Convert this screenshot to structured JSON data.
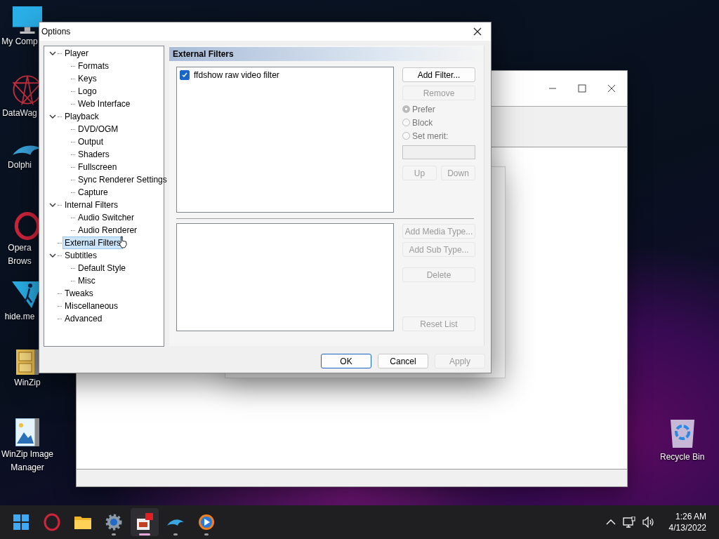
{
  "desktop_icons": [
    {
      "kind": "monitor",
      "lines": [
        "My Comp"
      ]
    },
    {
      "kind": "star",
      "lines": [
        "DataWag"
      ]
    },
    {
      "kind": "dolphin",
      "lines": [
        "Dolphi"
      ]
    },
    {
      "kind": "opera",
      "lines": [
        "Opera",
        "Brows"
      ]
    },
    {
      "kind": "hide",
      "lines": [
        "hide.me"
      ]
    },
    {
      "kind": "winzip",
      "lines": [
        "WinZip"
      ]
    },
    {
      "kind": "image",
      "lines": [
        "WinZip Image",
        "Manager"
      ]
    }
  ],
  "recycle_bin": {
    "label": "Recycle Bin"
  },
  "dialog": {
    "title": "Options",
    "tree": [
      {
        "label": "Player",
        "expanded": true,
        "selected": false,
        "children": [
          {
            "label": "Formats",
            "selected": false
          },
          {
            "label": "Keys",
            "selected": false
          },
          {
            "label": "Logo",
            "selected": false
          },
          {
            "label": "Web Interface",
            "selected": false
          }
        ]
      },
      {
        "label": "Playback",
        "expanded": true,
        "selected": false,
        "children": [
          {
            "label": "DVD/OGM",
            "selected": false
          },
          {
            "label": "Output",
            "selected": false
          },
          {
            "label": "Shaders",
            "selected": false
          },
          {
            "label": "Fullscreen",
            "selected": false
          },
          {
            "label": "Sync Renderer Settings",
            "selected": false
          },
          {
            "label": "Capture",
            "selected": false
          }
        ]
      },
      {
        "label": "Internal Filters",
        "expanded": true,
        "selected": false,
        "children": [
          {
            "label": "Audio Switcher",
            "selected": false
          },
          {
            "label": "Audio Renderer",
            "selected": false
          }
        ]
      },
      {
        "label": "External Filters",
        "selected": true
      },
      {
        "label": "Subtitles",
        "expanded": true,
        "selected": false,
        "children": [
          {
            "label": "Default Style",
            "selected": false
          },
          {
            "label": "Misc",
            "selected": false
          }
        ]
      },
      {
        "label": "Tweaks",
        "selected": false
      },
      {
        "label": "Miscellaneous",
        "selected": false
      },
      {
        "label": "Advanced",
        "selected": false
      }
    ],
    "page_title": "External Filters",
    "filters": [
      {
        "label": "ffdshow raw video filter",
        "checked": true
      }
    ],
    "filter_buttons": [
      {
        "label": "Add Filter...",
        "disabled": false
      },
      {
        "label": "Remove",
        "disabled": true
      }
    ],
    "merit_options": [
      {
        "label": "Prefer",
        "selected": true
      },
      {
        "label": "Block",
        "selected": false
      },
      {
        "label": "Set merit:",
        "selected": false
      }
    ],
    "merit_field": {
      "disabled": true
    },
    "move_buttons": [
      {
        "label": "Up",
        "disabled": true
      },
      {
        "label": "Down",
        "disabled": true
      }
    ],
    "type_buttons": [
      {
        "label": "Add Media Type...",
        "disabled": true
      },
      {
        "label": "Add Sub Type...",
        "disabled": true
      },
      {
        "label": "Delete",
        "disabled": true
      }
    ],
    "reset_button": {
      "label": "Reset List",
      "disabled": true
    },
    "footer_buttons": [
      {
        "label": "OK",
        "disabled": false,
        "default": true
      },
      {
        "label": "Cancel",
        "disabled": false,
        "default": false
      },
      {
        "label": "Apply",
        "disabled": true,
        "default": false
      }
    ]
  },
  "taskbar": {
    "apps": [
      {
        "kind": "start",
        "running": false,
        "active": false
      },
      {
        "kind": "opera",
        "running": false,
        "active": false
      },
      {
        "kind": "folder",
        "running": false,
        "active": false
      },
      {
        "kind": "gear",
        "running": true,
        "active": false
      },
      {
        "kind": "player",
        "running": true,
        "active": true
      },
      {
        "kind": "dolphin",
        "running": true,
        "active": false
      },
      {
        "kind": "media",
        "running": true,
        "active": false
      }
    ],
    "time": "1:26 AM",
    "date": "4/13/2022"
  }
}
